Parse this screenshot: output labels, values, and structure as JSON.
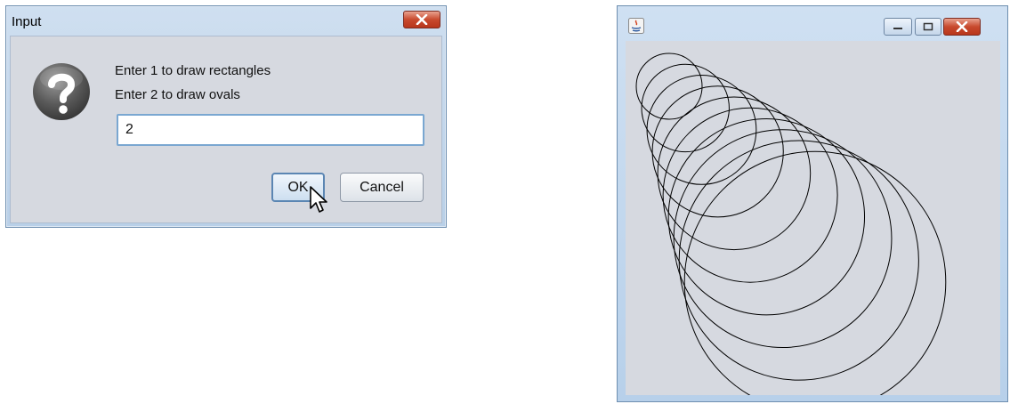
{
  "dialog": {
    "title": "Input",
    "close_icon": "close-icon",
    "question_icon": "question-icon",
    "prompt_line_1": "Enter 1 to draw rectangles",
    "prompt_line_2": "Enter 2 to draw ovals",
    "input_value": "2",
    "ok_label": "OK",
    "cancel_label": "Cancel"
  },
  "frame": {
    "app_icon": "java-icon",
    "minimize_icon": "minimize-icon",
    "maximize_icon": "maximize-icon",
    "close_icon": "close-icon",
    "shape": "oval",
    "oval_count": 10
  },
  "colors": {
    "titlebar": "#c4d8ee",
    "panel": "#d6d9e0",
    "close_button": "#c84a2e",
    "stroke": "#000000"
  }
}
